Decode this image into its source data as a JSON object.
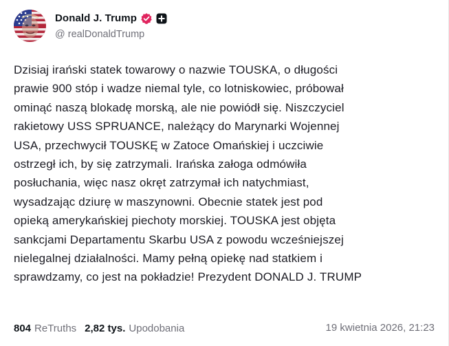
{
  "author": {
    "display_name": "Donald J. Trump",
    "handle": "@ realDonaldTrump",
    "verified_icon": "verified-badge-icon",
    "plus_icon": "plus-square-icon",
    "verified_color": "#e0245e"
  },
  "post": {
    "lines": [
      "Dzisiaj irański statek towarowy o nazwie TOUSKA, o długości",
      "prawie 900 stóp i wadze niemal tyle, co lotniskowiec, próbował",
      "ominąć naszą blokadę morską, ale nie powiódł się. Niszczyciel",
      "rakietowy USS SPRUANCE, należący do Marynarki Wojennej",
      "USA, przechwycił TOUSKĘ w Zatoce Omańskiej i uczciwie",
      "ostrzegł ich, by się zatrzymali. Irańska załoga odmówiła",
      "posłuchania, więc nasz okręt zatrzymał ich natychmiast,",
      "wysadzając dziurę w maszynowni. Obecnie statek jest pod",
      "opieką amerykańskiej piechoty morskiej. TOUSKA jest objęta",
      "sankcjami Departamentu Skarbu USA z powodu wcześniejszej",
      "nielegalnej działalności. Mamy pełną opiekę nad statkiem i",
      "sprawdzamy, co jest na pokładzie! Prezydent DONALD J. TRUMP"
    ]
  },
  "stats": {
    "retruths_count": "804",
    "retruths_label": "ReTruths",
    "likes_count": "2,82 tys.",
    "likes_label": "Upodobania"
  },
  "timestamp": "19 kwietnia 2026, 21:23"
}
